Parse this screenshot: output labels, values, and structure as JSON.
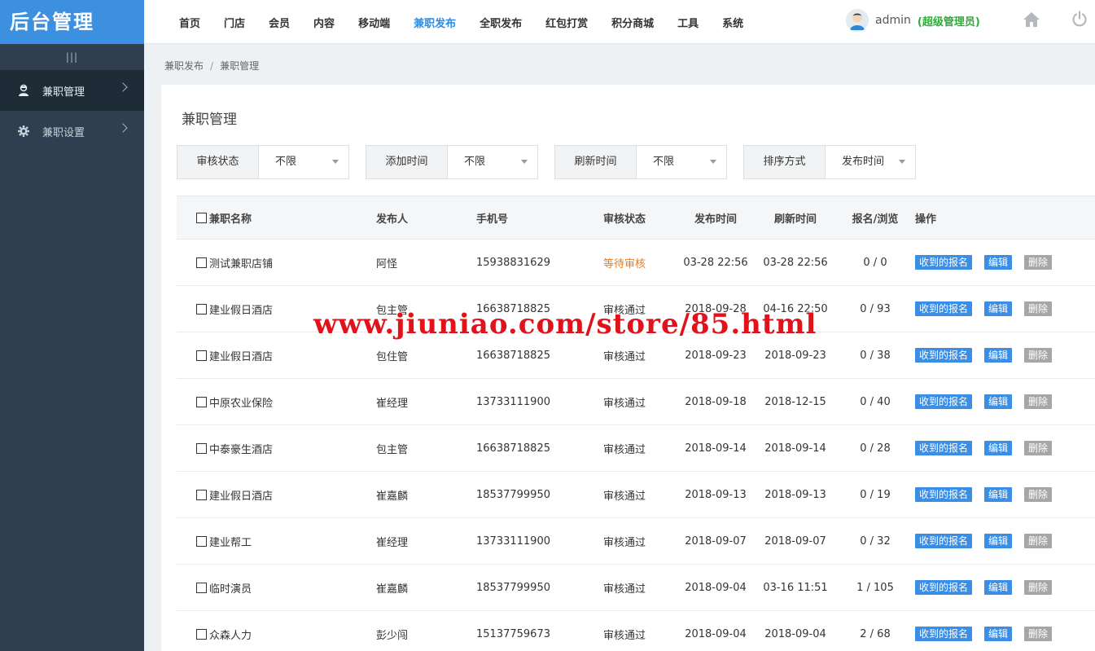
{
  "app": {
    "logo": "后台管理"
  },
  "sidebar": {
    "collapse_label": "|||",
    "items": [
      {
        "label": "兼职管理",
        "icon": "user-badge-icon"
      },
      {
        "label": "兼职设置",
        "icon": "gear-icon"
      }
    ]
  },
  "nav": {
    "items": [
      "首页",
      "门店",
      "会员",
      "内容",
      "移动端",
      "兼职发布",
      "全职发布",
      "红包打赏",
      "积分商城",
      "工具",
      "系统"
    ],
    "active": "兼职发布"
  },
  "user": {
    "name": "admin",
    "role": "(超级管理员)"
  },
  "breadcrumb": {
    "parent": "兼职发布",
    "sep": "/",
    "current": "兼职管理"
  },
  "page": {
    "title": "兼职管理"
  },
  "filters": [
    {
      "label": "审核状态",
      "value": "不限"
    },
    {
      "label": "添加时间",
      "value": "不限"
    },
    {
      "label": "刷新时间",
      "value": "不限"
    },
    {
      "label": "排序方式",
      "value": "发布时间"
    }
  ],
  "table": {
    "headers": {
      "name": "兼职名称",
      "publisher": "发布人",
      "phone": "手机号",
      "status": "审核状态",
      "publish_time": "发布时间",
      "refresh_time": "刷新时间",
      "stats": "报名/浏览",
      "ops": "操作"
    },
    "buttons": {
      "signups": "收到的报名",
      "edit": "编辑",
      "delete": "删除"
    },
    "rows": [
      {
        "name": "测试兼职店铺",
        "publisher": "阿怪",
        "phone": "15938831629",
        "status": "等待审核",
        "publish_time": "03-28 22:56",
        "refresh_time": "03-28 22:56",
        "stats": "0 / 0"
      },
      {
        "name": "建业假日酒店",
        "publisher": "包主管",
        "phone": "16638718825",
        "status": "审核通过",
        "publish_time": "2018-09-28",
        "refresh_time": "04-16 22:50",
        "stats": "0 / 93"
      },
      {
        "name": "建业假日酒店",
        "publisher": "包住管",
        "phone": "16638718825",
        "status": "审核通过",
        "publish_time": "2018-09-23",
        "refresh_time": "2018-09-23",
        "stats": "0 / 38"
      },
      {
        "name": "中原农业保险",
        "publisher": "崔经理",
        "phone": "13733111900",
        "status": "审核通过",
        "publish_time": "2018-09-18",
        "refresh_time": "2018-12-15",
        "stats": "0 / 40"
      },
      {
        "name": "中泰豪生酒店",
        "publisher": "包主管",
        "phone": "16638718825",
        "status": "审核通过",
        "publish_time": "2018-09-14",
        "refresh_time": "2018-09-14",
        "stats": "0 / 28"
      },
      {
        "name": "建业假日酒店",
        "publisher": "崔嘉麟",
        "phone": "18537799950",
        "status": "审核通过",
        "publish_time": "2018-09-13",
        "refresh_time": "2018-09-13",
        "stats": "0 / 19"
      },
      {
        "name": "建业帮工",
        "publisher": "崔经理",
        "phone": "13733111900",
        "status": "审核通过",
        "publish_time": "2018-09-07",
        "refresh_time": "2018-09-07",
        "stats": "0 / 32"
      },
      {
        "name": "临时演员",
        "publisher": "崔嘉麟",
        "phone": "18537799950",
        "status": "审核通过",
        "publish_time": "2018-09-04",
        "refresh_time": "03-16 11:51",
        "stats": "1 / 105"
      },
      {
        "name": "众森人力",
        "publisher": "彭少闯",
        "phone": "15137759673",
        "status": "审核通过",
        "publish_time": "2018-09-04",
        "refresh_time": "2018-09-04",
        "stats": "2 / 68"
      }
    ]
  },
  "watermark": "www.jiuniao.com/store/85.html",
  "colors": {
    "accent": "#2e8be0",
    "sidebar": "#2f3f4f",
    "logo_bg": "#3d8fe0",
    "pending": "#e67e22",
    "role": "#2eab36",
    "watermark": "#e0121b"
  }
}
